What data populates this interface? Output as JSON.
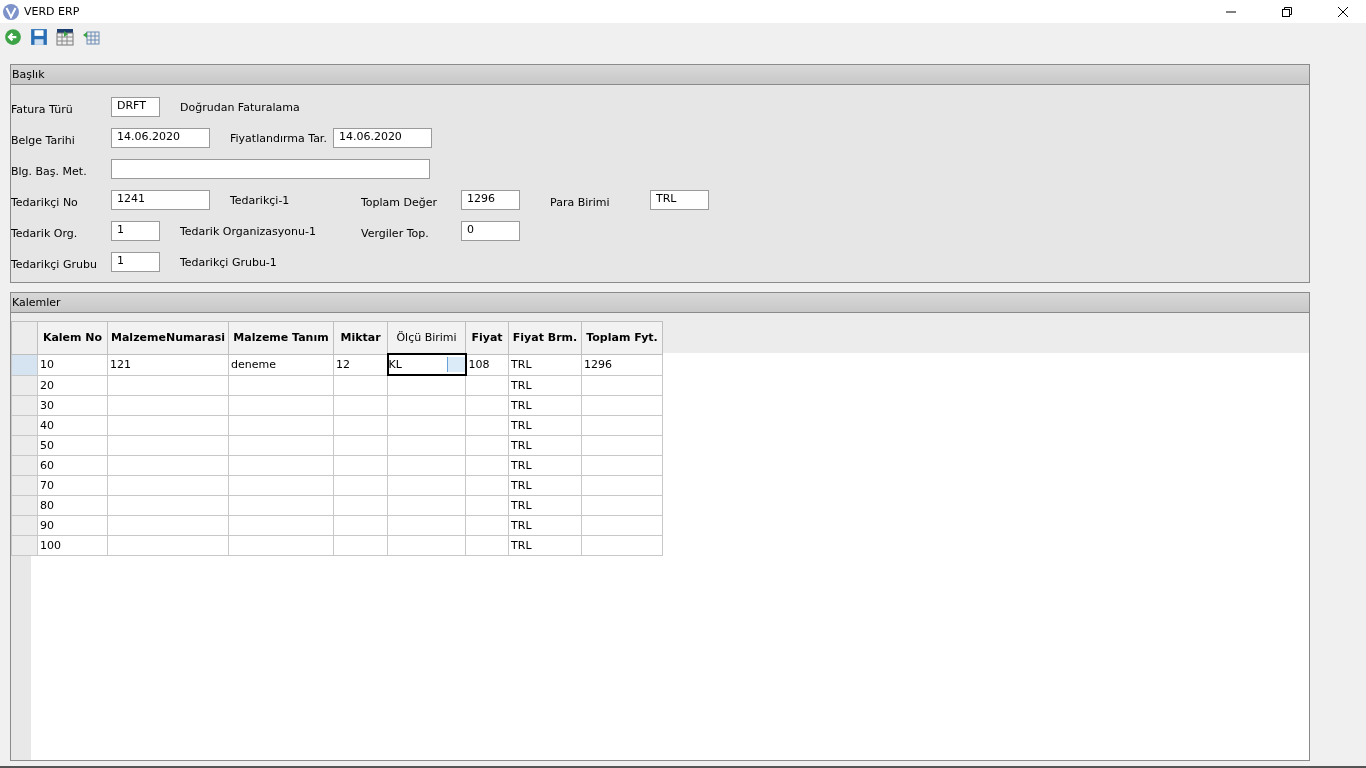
{
  "window": {
    "title": "VERD ERP",
    "controls": [
      {
        "kind": "minimize"
      },
      {
        "kind": "restore"
      },
      {
        "kind": "close"
      }
    ]
  },
  "toolbar": [
    {
      "kind": "back"
    },
    {
      "kind": "save"
    },
    {
      "kind": "table-add"
    },
    {
      "kind": "table-import"
    }
  ],
  "header": {
    "title": "Başlık",
    "rows": [
      {
        "left": [
          {
            "kind": "label",
            "text": "Fatura Türü"
          },
          {
            "kind": "short",
            "value": "DRFT"
          },
          {
            "kind": "text",
            "text": "Doğrudan Faturalama"
          }
        ],
        "right": []
      },
      {
        "left": [
          {
            "kind": "label",
            "text": "Belge Tarihi"
          },
          {
            "kind": "mid",
            "value": "14.06.2020"
          },
          {
            "kind": "text",
            "text": "Fiyatlandırma Tar."
          },
          {
            "kind": "mid",
            "value": "14.06.2020"
          }
        ],
        "right": []
      },
      {
        "left": [
          {
            "kind": "label",
            "text": "Blg. Baş. Met."
          },
          {
            "kind": "wide"
          }
        ],
        "right": []
      },
      {
        "left": [
          {
            "kind": "label",
            "text": "Tedarikçi No"
          },
          {
            "kind": "mid",
            "value": "1241"
          },
          {
            "kind": "text",
            "text": "Tedarikçi-1"
          }
        ],
        "right": [
          {
            "kind": "label",
            "text": "Toplam Değer"
          },
          {
            "kind": "mid",
            "value": "1296"
          },
          {
            "kind": "label",
            "text": "Para Birimi"
          },
          {
            "kind": "mid",
            "value": "TRL"
          }
        ]
      },
      {
        "left": [
          {
            "kind": "label",
            "text": "Tedarik Org."
          },
          {
            "kind": "short",
            "value": "1"
          },
          {
            "kind": "text",
            "text": "Tedarik Organizasyonu-1"
          }
        ],
        "right": [
          {
            "kind": "label",
            "text": "Vergiler Top."
          },
          {
            "kind": "mid",
            "value": "0"
          }
        ]
      },
      {
        "left": [
          {
            "kind": "label",
            "text": "Tedarikçi Grubu"
          },
          {
            "kind": "short",
            "value": "1"
          },
          {
            "kind": "text",
            "text": "Tedarikçi Grubu-1"
          }
        ],
        "right": []
      }
    ]
  },
  "items": {
    "title": "Kalemler",
    "columns": [
      {
        "label": "Kalem No",
        "selected": false
      },
      {
        "label": "MalzemeNumarasi",
        "selected": false
      },
      {
        "label": "Malzeme Tanım",
        "selected": false
      },
      {
        "label": "Miktar",
        "selected": false
      },
      {
        "label": "Ölçü Birimi",
        "selected": true
      },
      {
        "label": "Fiyat",
        "selected": false
      },
      {
        "label": "Fiyat Brm.",
        "selected": false
      },
      {
        "label": "Toplam Fyt.",
        "selected": false
      }
    ],
    "rows": [
      {
        "selected": true,
        "cells": [
          "10",
          "121",
          "deneme",
          "12",
          "KL",
          "108",
          "TRL",
          "1296"
        ]
      },
      {
        "selected": false,
        "cells": [
          "20",
          null,
          null,
          null,
          null,
          null,
          "TRL",
          null
        ]
      },
      {
        "selected": false,
        "cells": [
          "30",
          null,
          null,
          null,
          null,
          null,
          "TRL",
          null
        ]
      },
      {
        "selected": false,
        "cells": [
          "40",
          null,
          null,
          null,
          null,
          null,
          "TRL",
          null
        ]
      },
      {
        "selected": false,
        "cells": [
          "50",
          null,
          null,
          null,
          null,
          null,
          "TRL",
          null
        ]
      },
      {
        "selected": false,
        "cells": [
          "60",
          null,
          null,
          null,
          null,
          null,
          "TRL",
          null
        ]
      },
      {
        "selected": false,
        "cells": [
          "70",
          null,
          null,
          null,
          null,
          null,
          "TRL",
          null
        ]
      },
      {
        "selected": false,
        "cells": [
          "80",
          null,
          null,
          null,
          null,
          null,
          "TRL",
          null
        ]
      },
      {
        "selected": false,
        "cells": [
          "90",
          null,
          null,
          null,
          null,
          null,
          "TRL",
          null
        ]
      },
      {
        "selected": false,
        "cells": [
          "100",
          null,
          null,
          null,
          null,
          null,
          "TRL",
          null
        ]
      }
    ]
  }
}
